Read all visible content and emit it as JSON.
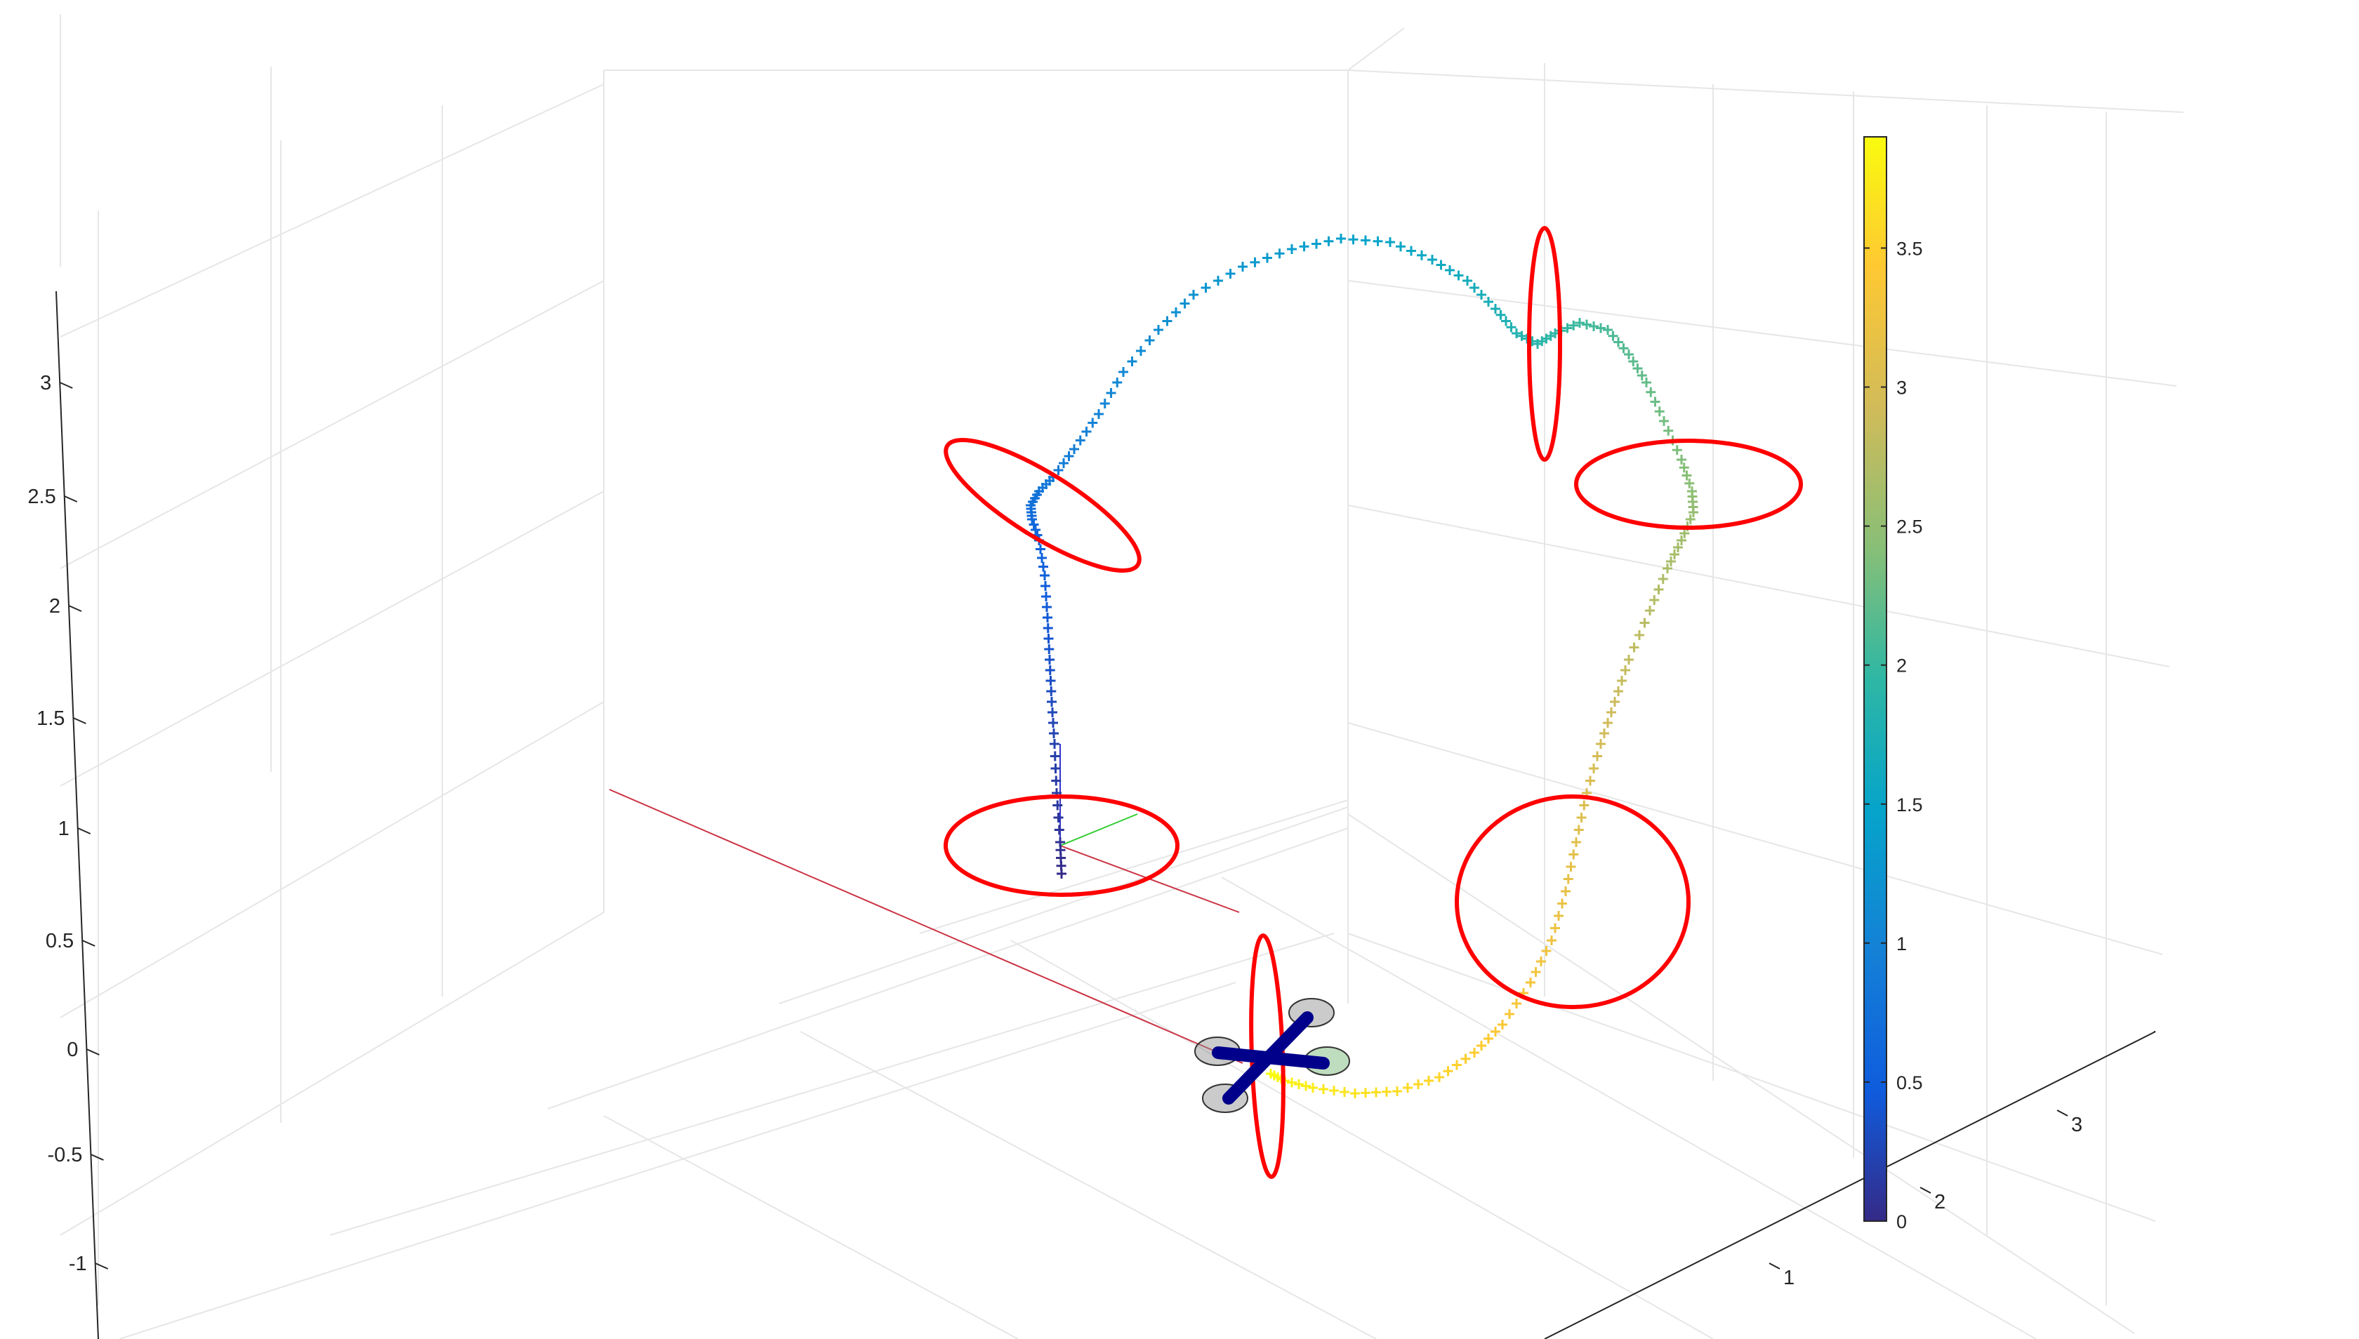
{
  "chart_data": {
    "type": "scatter",
    "title": "",
    "xlabel": "",
    "ylabel": "",
    "zlabel": "",
    "grid": true,
    "box": false,
    "view": "3-D perspective, quadrotor trajectory through five gates",
    "z_ticks": [
      "3",
      "2.5",
      "2",
      "1.5",
      "1",
      "0.5",
      "0",
      "-0.5",
      "-1"
    ],
    "x_ticks": [
      "1",
      "2",
      "3"
    ],
    "colorbar": {
      "colormap": "parula",
      "limits": [
        0,
        3.9
      ],
      "tick_values": [
        0,
        0.5,
        1,
        1.5,
        2,
        2.5,
        3,
        3.5
      ],
      "tick_labels": [
        "0",
        "0.5",
        "1",
        "1.5",
        "2",
        "2.5",
        "3",
        "3.5"
      ]
    },
    "trajectory": {
      "marker": "+",
      "color_by": "time",
      "points_count_approx": 200
    },
    "gates": {
      "count": 5,
      "color": "#ff0000"
    },
    "vehicle": {
      "name": "quadrotor",
      "arm_color": "#00008b",
      "rotor_colors": [
        "#8c8c8c",
        "#8c8c8c",
        "#8c8c8c",
        "#6fb26f"
      ]
    },
    "reference_axes": {
      "x_axis_color": "#cc3344",
      "y_axis_color": "#33cc33",
      "z_axis_color": "#3333cc"
    }
  }
}
